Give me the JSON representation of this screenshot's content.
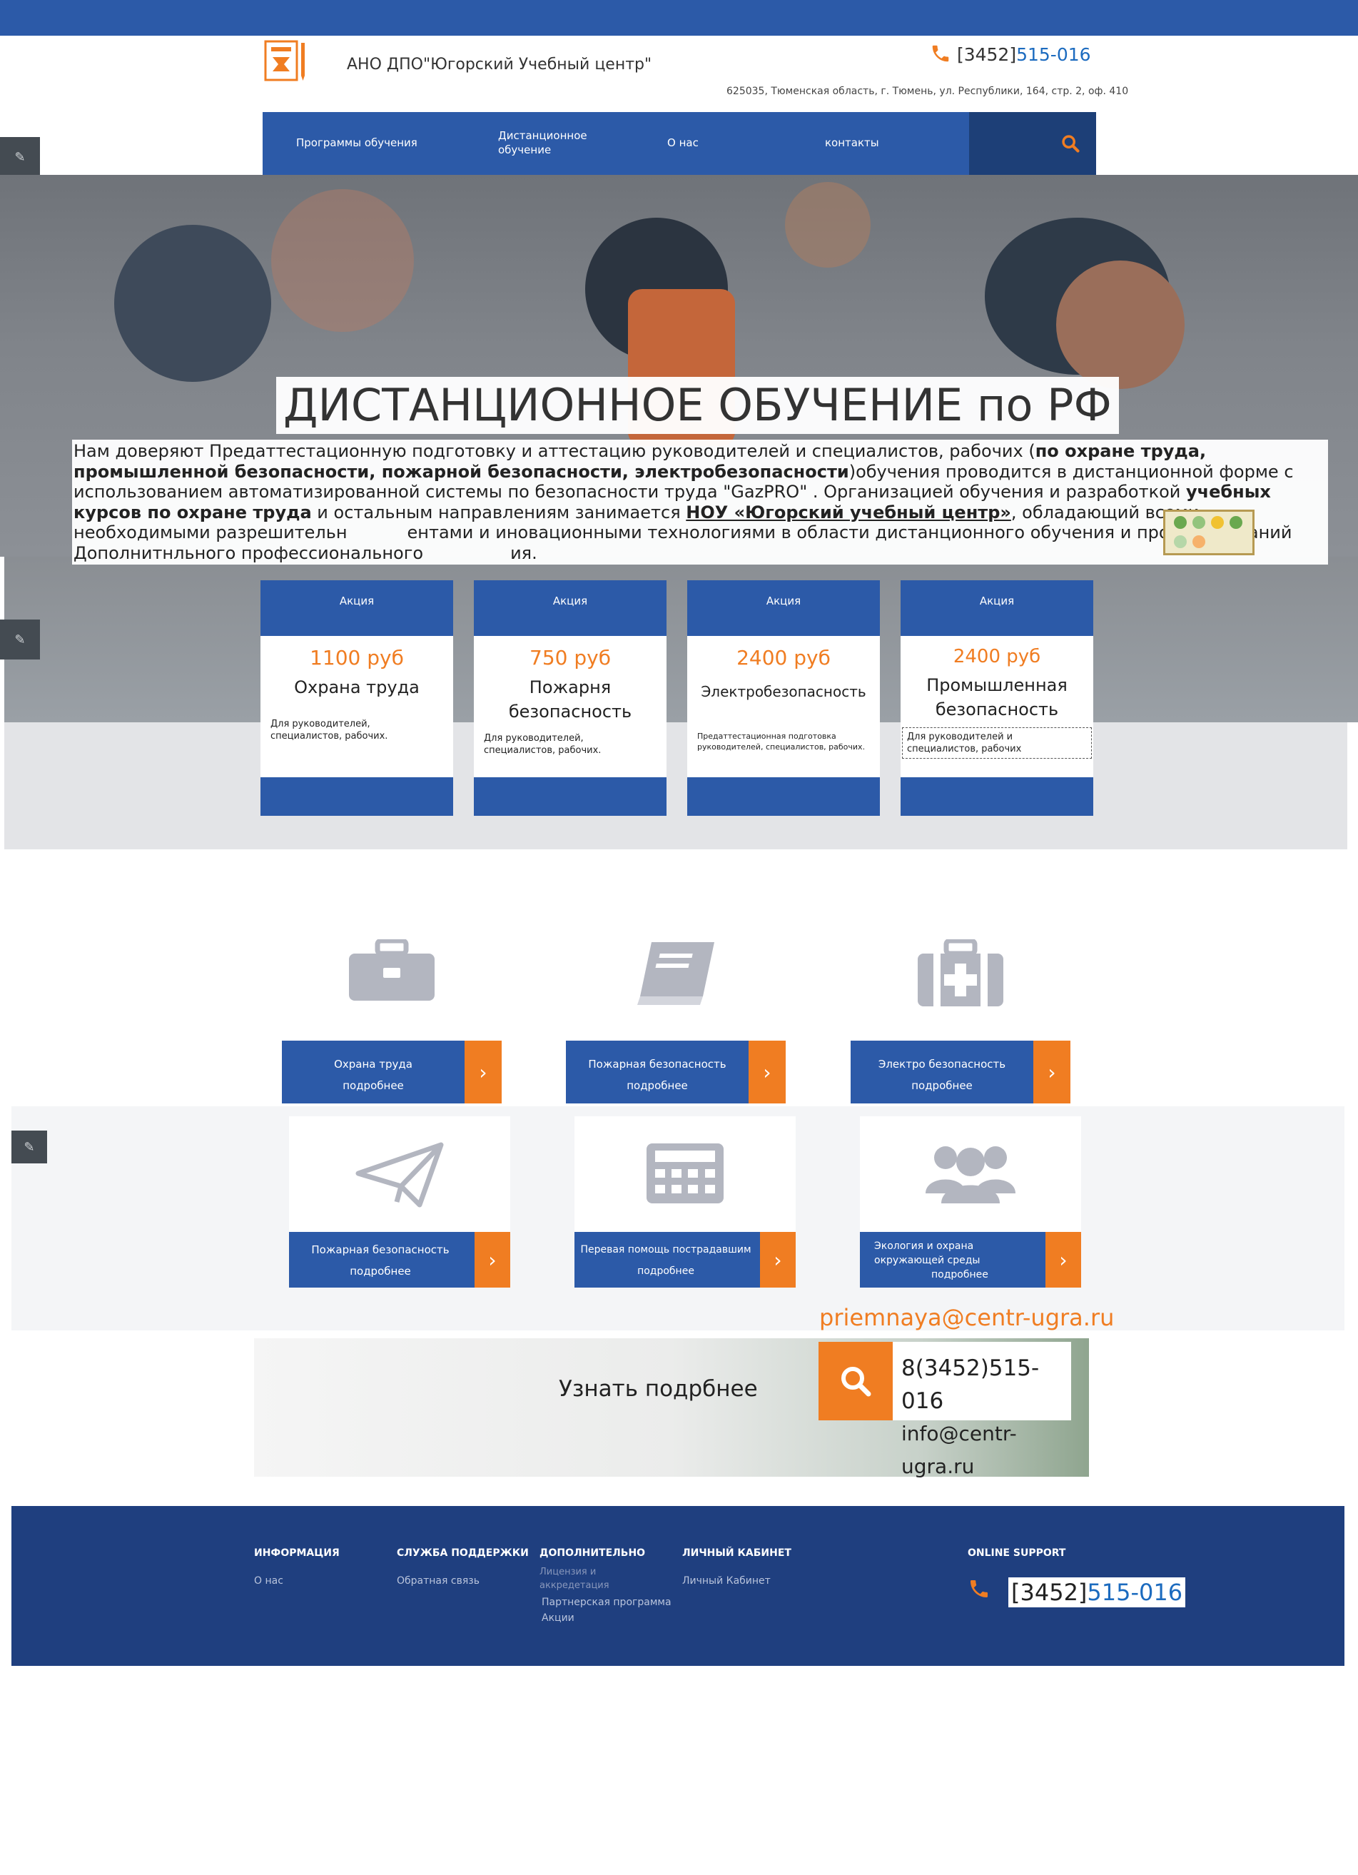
{
  "header": {
    "org_name": "АНО ДПО\"Югорский Учебный центр\"",
    "phone_code": "[3452]",
    "phone_number": "515-016",
    "address": "625035, Тюменская область, г. Тюмень, ул. Республики, 164, стр. 2, оф. 410"
  },
  "nav": {
    "items": [
      {
        "label": "Программы обучения"
      },
      {
        "label": "Дистанционное"
      },
      {
        "label": "обучение"
      },
      {
        "label": "О нас"
      },
      {
        "label": "контакты"
      }
    ]
  },
  "hero": {
    "title": "ДИСТАНЦИОННОЕ ОБУЧЕНИЕ по РФ",
    "t1": "Нам доверяют Предаттестационную подготовку и аттестацию руководителей и специалистов, рабочих (",
    "b1": "по охране труда, промышленной безопасности, пожарной безопасности, электробезопасности",
    "t2": ")обучения проводится в дистанционной форме с использованием автоматизированной системы по безопасности труда \"GazPRO\" . Организацией обучения и разработкой ",
    "b2": "учебных курсов по охране труда",
    "t3": " и остальным направлениям занимается ",
    "link": "НОУ «Югорский учебный центр»",
    "t4": ", обладающий всеми необходимыми разрешительн",
    "t5": "ентами и иновационными технологиями в области дистанционного обучения и проверки знаний Дополнитнльного профессионального",
    "t6": "ия."
  },
  "promos": [
    {
      "head": "Акция",
      "price": "1100 руб",
      "name": "Охрана труда",
      "note": "Для руководителей, специалистов, рабочих."
    },
    {
      "head": "Акция",
      "price": "750 руб",
      "name": "Пожарня безопасность",
      "note": "Для руководителей, специалистов, рабочих."
    },
    {
      "head": "Акция",
      "price": "2400 руб",
      "name": "Электробезопасность",
      "note": "Предаттестационная подготовка руководителей, специалистов, рабочих."
    },
    {
      "head": "Акция",
      "price": "2400 руб",
      "name": "Промышленная безопасность",
      "note": "Для руководителей и специалистов, рабочих"
    }
  ],
  "tiles": [
    {
      "label": "Охрана труда",
      "more": "подробнее",
      "icon": "briefcase-icon"
    },
    {
      "label": "Пожарная безопасность",
      "more": "подробнее",
      "icon": "book-icon"
    },
    {
      "label": "Электро безопасность",
      "more": "подробнее",
      "icon": "first-aid-kit-icon"
    },
    {
      "label": "Пожарная безопасность",
      "more": "подробнее",
      "icon": "paper-plane-icon"
    },
    {
      "label": "Перевая помощь пострадавшим",
      "more": "подробнее",
      "icon": "calculator-icon"
    },
    {
      "label": "Экология и охрана окружающей среды",
      "more": "подробнее",
      "icon": "users-icon"
    }
  ],
  "cta": {
    "email_top": "priemnaya@centr-ugra.ru",
    "text": "Узнать подрбнее",
    "phone": "8(3452)515-016",
    "email": "info@centr-ugra.ru"
  },
  "footer": {
    "col1_head": "ИНФОРМАЦИЯ",
    "col1_l1": "О нас",
    "col2_head": "СЛУЖБА ПОДДЕРЖКИ",
    "col2_l1": "Обратная связь",
    "col3_head": "ДОПОЛНИТЕЛЬНО",
    "col3_l1a": "Лицензия и",
    "col3_l1b": "аккредетация",
    "col3_l2": "Партнерская программа",
    "col3_l3": "Акции",
    "col4_head": "ЛИЧНЫЙ КАБИНЕТ",
    "col4_l1": "Личный Кабинет",
    "col5_head": "ONLINE SUPPORT",
    "phone_code": "[3452]",
    "phone_number": "515-016"
  },
  "colors": {
    "brand_blue": "#2c5aa8",
    "accent_orange": "#f07d22",
    "footer_blue": "#1f3f7f"
  }
}
